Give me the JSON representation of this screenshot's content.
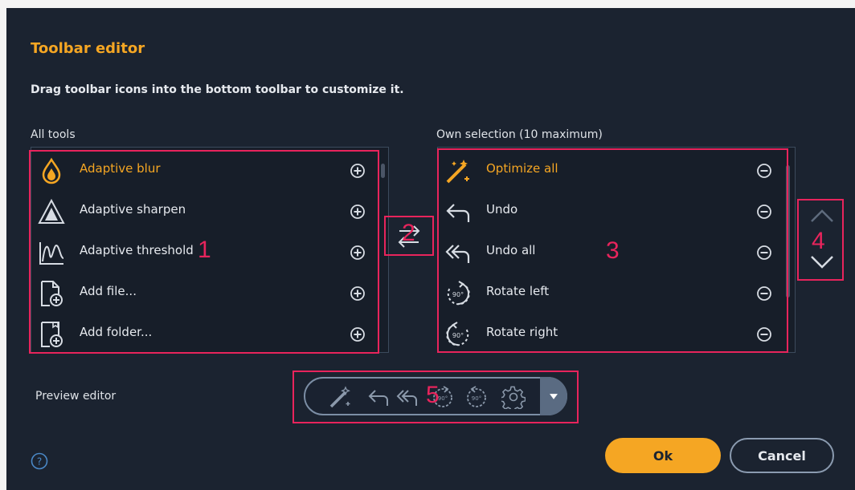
{
  "dialog": {
    "title": "Toolbar editor",
    "subtitle": "Drag toolbar icons into the bottom toolbar to customize it."
  },
  "all_tools": {
    "label": "All tools",
    "items": [
      {
        "label": "Adaptive blur",
        "icon": "drop-icon",
        "action": "add",
        "highlight": true
      },
      {
        "label": "Adaptive sharpen",
        "icon": "triangle-icon",
        "action": "add",
        "highlight": false
      },
      {
        "label": "Adaptive threshold",
        "icon": "wave-icon",
        "action": "add",
        "highlight": false
      },
      {
        "label": "Add file...",
        "icon": "file-add-icon",
        "action": "add",
        "highlight": false
      },
      {
        "label": "Add folder...",
        "icon": "folder-add-icon",
        "action": "add",
        "highlight": false
      }
    ]
  },
  "own_selection": {
    "label": "Own selection (10 maximum)",
    "items": [
      {
        "label": "Optimize all",
        "icon": "magic-wand-icon",
        "action": "remove",
        "highlight": true
      },
      {
        "label": "Undo",
        "icon": "undo-icon",
        "action": "remove",
        "highlight": false
      },
      {
        "label": "Undo all",
        "icon": "undo-all-icon",
        "action": "remove",
        "highlight": false
      },
      {
        "label": "Rotate left",
        "icon": "rotate-left-icon",
        "action": "remove",
        "highlight": false
      },
      {
        "label": "Rotate right",
        "icon": "rotate-right-icon",
        "action": "remove",
        "highlight": false
      }
    ]
  },
  "annotations": [
    "1",
    "2",
    "3",
    "4",
    "5"
  ],
  "preview": {
    "label": "Preview editor",
    "icons": [
      "magic-wand-icon",
      "undo-icon",
      "undo-all-icon",
      "rotate-left-icon",
      "rotate-right-icon",
      "gear-icon"
    ]
  },
  "footer": {
    "ok_label": "Ok",
    "cancel_label": "Cancel"
  },
  "colors": {
    "accent": "#f5a623",
    "annotation": "#e8245c",
    "background": "#1b2330"
  }
}
